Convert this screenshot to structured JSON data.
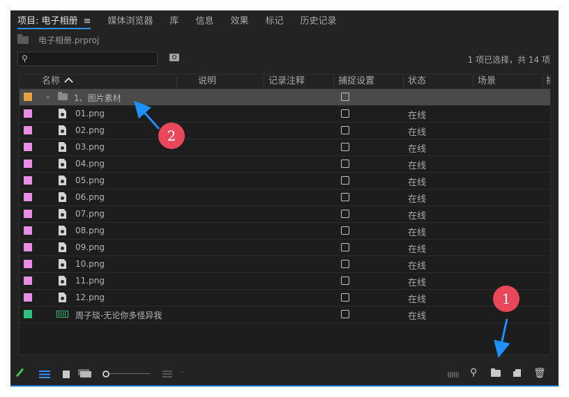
{
  "tabs": [
    {
      "label": "项目: 电子相册",
      "active": true
    },
    {
      "label": "媒体浏览器"
    },
    {
      "label": "库"
    },
    {
      "label": "信息"
    },
    {
      "label": "效果"
    },
    {
      "label": "标记"
    },
    {
      "label": "历史记录"
    }
  ],
  "tab_menu_glyph": "≡",
  "project_file": "电子相册.prproj",
  "search": {
    "value": "",
    "icon": "search-icon"
  },
  "selection_info": "1 项已选择，共 14 项",
  "columns": {
    "name": "名称",
    "description": "说明",
    "log_note": "记录注释",
    "capture_settings": "捕捉设置",
    "status": "状态",
    "scene": "场景",
    "extra": "拍"
  },
  "rows": [
    {
      "type": "bin",
      "name": "1、图片素材",
      "label_color": "#e6a23c",
      "expanded": true,
      "selected": true
    },
    {
      "type": "image",
      "name": "01.png",
      "status": "在线",
      "label_color": "#e88ee6"
    },
    {
      "type": "image",
      "name": "02.png",
      "status": "在线",
      "label_color": "#e88ee6"
    },
    {
      "type": "image",
      "name": "03.png",
      "status": "在线",
      "label_color": "#e88ee6"
    },
    {
      "type": "image",
      "name": "04.png",
      "status": "在线",
      "label_color": "#e88ee6"
    },
    {
      "type": "image",
      "name": "05.png",
      "status": "在线",
      "label_color": "#e88ee6"
    },
    {
      "type": "image",
      "name": "06.png",
      "status": "在线",
      "label_color": "#e88ee6"
    },
    {
      "type": "image",
      "name": "07.png",
      "status": "在线",
      "label_color": "#e88ee6"
    },
    {
      "type": "image",
      "name": "08.png",
      "status": "在线",
      "label_color": "#e88ee6"
    },
    {
      "type": "image",
      "name": "09.png",
      "status": "在线",
      "label_color": "#e88ee6"
    },
    {
      "type": "image",
      "name": "10.png",
      "status": "在线",
      "label_color": "#e88ee6"
    },
    {
      "type": "image",
      "name": "11.png",
      "status": "在线",
      "label_color": "#e88ee6"
    },
    {
      "type": "image",
      "name": "12.png",
      "status": "在线",
      "label_color": "#e88ee6"
    },
    {
      "type": "audio",
      "name": "周子琰-无论你多怪异我",
      "status": "在线",
      "label_color": "#2ec27e"
    }
  ],
  "footer_icons": [
    "pencil-icon",
    "list-view-icon",
    "icon-view-icon",
    "freeform-view-icon",
    "zoom-slider",
    "sort-icon",
    "automate-icon",
    "find-icon",
    "new-bin-icon",
    "new-item-icon",
    "trash-icon"
  ],
  "callouts": [
    {
      "number": "1"
    },
    {
      "number": "2"
    }
  ],
  "colors": {
    "accent": "#2e8fff",
    "callout": "#e8485a",
    "panel": "#232323"
  }
}
